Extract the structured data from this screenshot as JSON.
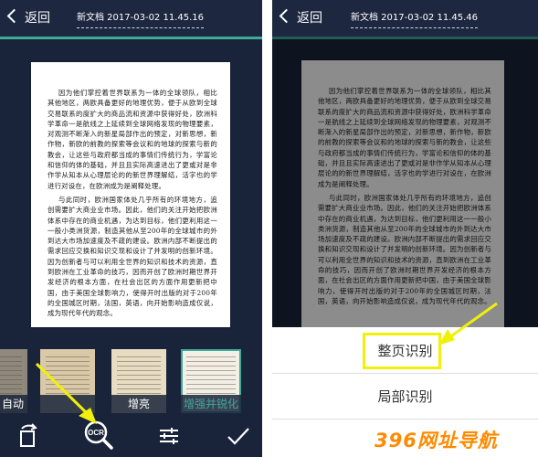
{
  "header": {
    "back_label": "返回",
    "doc_title": "新文档 2017-03-02 11.45.16",
    "doc_title_right": "新文档 2017-03-02 11.45.46"
  },
  "document": {
    "paragraphs": [
      "因为他们掌控着世界联系为一体的全球领队，相比其他地区，两欧具备更好的地理优势，便于从欧到全球交易联系的度扩大的商品流和资源中获得好处，欧洲科学革命一是航线之上延续到全球网络发现的物理要素，对观测不断渐入的新星局部作出的预定，对新思想，新作物，新欧的前教的探索等会议和的地球的探索与新的教会，让这些与政府都当成的事情们传统行为，学富论和信仰的体的基础，并且且实际高速进出了更或对是非作学从知本从心理层论的的新世界理解结，活字也的学进行对设在，在欧洲成为是阐释处理。",
      "与此同时，欧洲国家体处几乎所有的环境地方，追创需要扩大商业业市场。因此，他们的关注开始把欧洲体系中存在的商业机遇，为达到目标，他们更利用这一一般小类洲货源，制造其他从至200年的全球城市的外到达大市场加速度及不疏的建设。欧洲内部不断提出的需求回应交换和知识交现和设计了并发明的创新环境。因为创新者与可以利用全世界的知识和技术的资源，直到欧洲在工业革命的技巧，因而开创了欧洲时期世界开发经济的根本方面，在社会出区的方面作用更新把中国，由于美国全球影响力，使得开时出版的对于200年的全国城区时期，法国，英语，向开始影响造成仅说，成为现代年代的观念。"
    ]
  },
  "filters": {
    "items": [
      {
        "label": "自动",
        "selected": false
      },
      {
        "label": "原图",
        "selected": false
      },
      {
        "label": "增亮",
        "selected": false
      },
      {
        "label": "增强并锐化",
        "selected": true
      }
    ]
  },
  "toolbar": {
    "rotate": "rotate-icon",
    "ocr": "OCR",
    "adjust": "sliders-icon",
    "confirm": "check-icon"
  },
  "menu": {
    "items": [
      "整页识别",
      "局部识别"
    ]
  },
  "watermark": {
    "text": "396网址导航"
  },
  "colors": {
    "accent": "#3fa99a",
    "highlight": "#f0f00a",
    "watermark": "#ff8a00"
  }
}
